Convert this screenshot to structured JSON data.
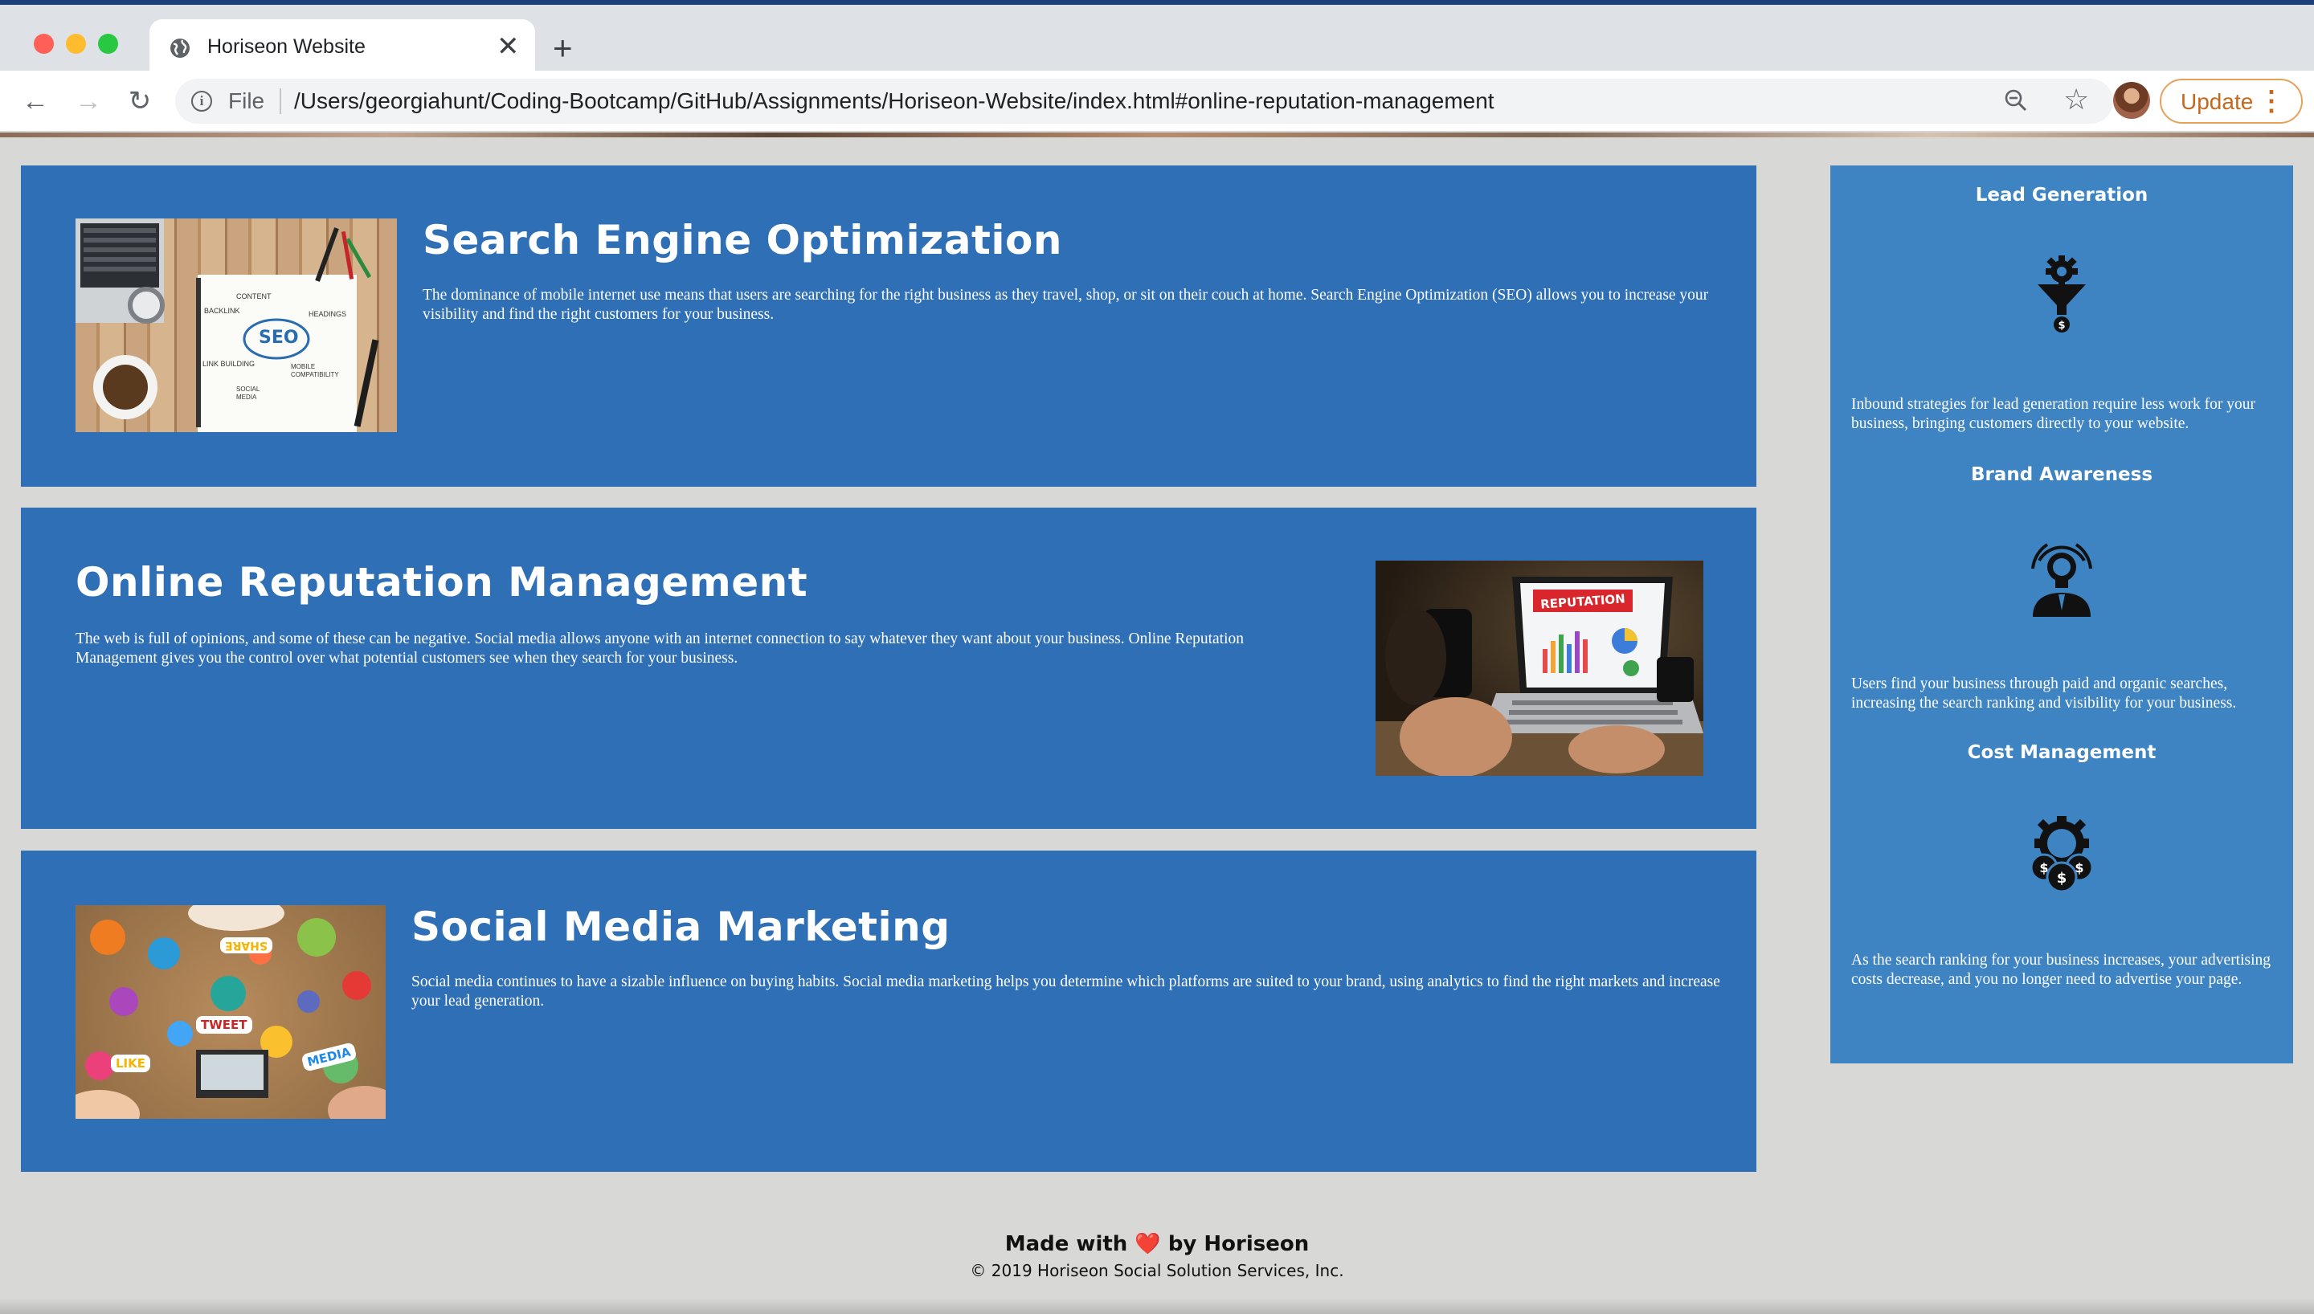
{
  "browser": {
    "tab_title": "Horiseon Website",
    "tab_close": "✕",
    "new_tab": "+",
    "scheme_label": "File",
    "url": "/Users/georgiahunt/Coding-Bootcamp/GitHub/Assignments/Horiseon-Website/index.html#online-reputation-management",
    "update_label": "Update",
    "menu_glyph": "⋮",
    "back_glyph": "←",
    "forward_glyph": "→",
    "reload_glyph": "↻",
    "star_glyph": "☆",
    "info_glyph": "i"
  },
  "articles": [
    {
      "title": "Search Engine Optimization",
      "text": "The dominance of mobile internet use means that users are searching for the right business as they travel, shop, or sit on their couch at home. Search Engine Optimization (SEO) allows you to increase your visibility and find the right customers for your business.",
      "image_label": "SEO",
      "image_words": [
        "CONTENT",
        "BACKLINK",
        "HEADINGS",
        "LINK BUILDING",
        "MOBILE COMPATIBILITY",
        "SOCIAL MEDIA"
      ]
    },
    {
      "title": "Online Reputation Management",
      "text": "The web is full of opinions, and some of these can be negative. Social media allows anyone with an internet connection to say whatever they want about your business. Online Reputation Management gives you the control over what potential customers see when they search for your business.",
      "image_label": "REPUTATION"
    },
    {
      "title": "Social Media Marketing",
      "text": "Social media continues to have a sizable influence on buying habits. Social media marketing helps you determine which platforms are suited to your brand, using analytics to find the right markets and increase your lead generation.",
      "image_words": [
        "SHARE",
        "TWEET",
        "LIKE",
        "MEDIA"
      ]
    }
  ],
  "sidebar": [
    {
      "title": "Lead Generation",
      "icon": "lead-funnel-icon",
      "text": "Inbound strategies for lead generation require less work for your business, bringing customers directly to your website."
    },
    {
      "title": "Brand Awareness",
      "icon": "lightbulb-person-icon",
      "text": "Users find your business through paid and organic searches, increasing the search ranking and visibility for your business."
    },
    {
      "title": "Cost Management",
      "icon": "gear-dollar-icon",
      "text": "As the search ranking for your business increases, your advertising costs decrease, and you no longer need to advertise your page."
    }
  ],
  "footer": {
    "made_with": "Made with",
    "heart": "❤️",
    "by": "by Horiseon",
    "copyright": "© 2019 Horiseon Social Solution Services, Inc."
  },
  "colors": {
    "article_bg": "#2f6fb6",
    "sidebar_bg": "#3e83c2",
    "page_bg": "#d8d9d6",
    "update_accent": "#c5681b"
  }
}
